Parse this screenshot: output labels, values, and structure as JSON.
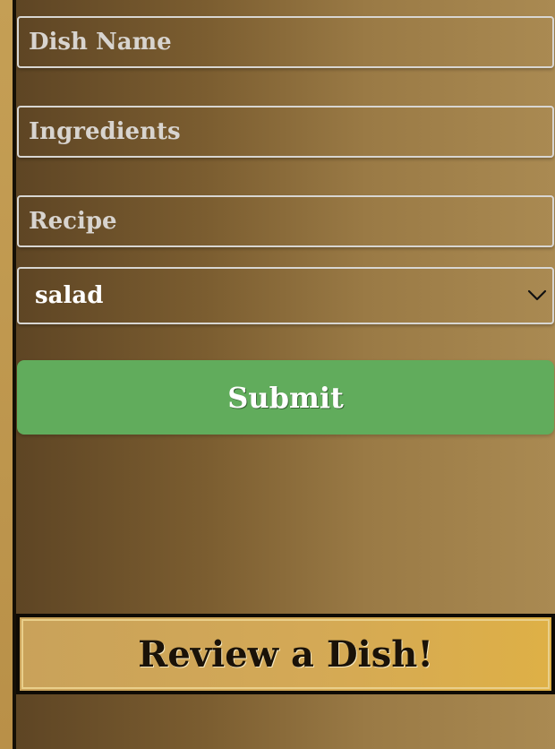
{
  "form": {
    "dish_name_placeholder": "Dish Name",
    "ingredients_placeholder": "Ingredients",
    "recipe_placeholder": "Recipe",
    "category_value": "salad",
    "submit_label": "Submit"
  },
  "review": {
    "label": "Review a Dish!"
  },
  "icons": {
    "select_arrow": "chevron-down-icon"
  },
  "colors": {
    "submit_green": "#61ac5c",
    "review_gold": "#d4a956"
  }
}
